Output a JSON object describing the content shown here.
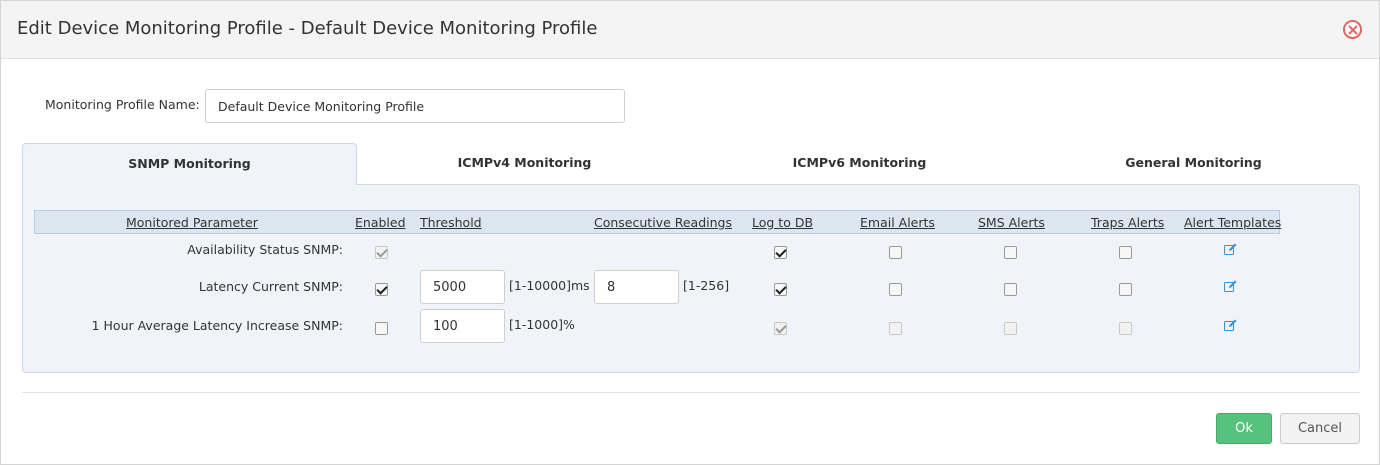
{
  "dialog": {
    "title": "Edit Device Monitoring Profile - Default Device Monitoring Profile",
    "close_icon": "close-circle-icon",
    "accent_close": "#e06666"
  },
  "profile": {
    "label": "Monitoring Profile Name:",
    "value": "Default Device Monitoring Profile"
  },
  "tabs": [
    {
      "label": "SNMP Monitoring",
      "active": true
    },
    {
      "label": "ICMPv4 Monitoring",
      "active": false
    },
    {
      "label": "ICMPv6 Monitoring",
      "active": false
    },
    {
      "label": "General Monitoring",
      "active": false
    }
  ],
  "grid": {
    "columns": {
      "parameter": "Monitored Parameter",
      "enabled": "Enabled",
      "threshold": "Threshold",
      "consecutive": "Consecutive Readings",
      "log": "Log to DB",
      "email": "Email Alerts",
      "sms": "SMS Alerts",
      "traps": "Traps Alerts",
      "templates": "Alert Templates"
    },
    "rows": [
      {
        "label": "Availability Status SNMP:",
        "enabled": {
          "checked": true,
          "disabled": true
        },
        "log": {
          "checked": true,
          "disabled": false
        },
        "email": {
          "checked": false,
          "disabled": false
        },
        "sms": {
          "checked": false,
          "disabled": false
        },
        "traps": {
          "checked": false,
          "disabled": false
        },
        "template_icon": "edit-icon"
      },
      {
        "label": "Latency Current SNMP:",
        "enabled": {
          "checked": true,
          "disabled": false
        },
        "threshold": "5000",
        "threshold_range": "[1-10000]ms",
        "consecutive": "8",
        "consecutive_range": "[1-256]",
        "log": {
          "checked": true,
          "disabled": false
        },
        "email": {
          "checked": false,
          "disabled": false
        },
        "sms": {
          "checked": false,
          "disabled": false
        },
        "traps": {
          "checked": false,
          "disabled": false
        },
        "template_icon": "edit-icon"
      },
      {
        "label": "1 Hour Average Latency Increase SNMP:",
        "enabled": {
          "checked": false,
          "disabled": false
        },
        "threshold": "100",
        "threshold_range": "[1-1000]%",
        "log": {
          "checked": true,
          "disabled": true
        },
        "email": {
          "checked": false,
          "disabled": true
        },
        "sms": {
          "checked": false,
          "disabled": true
        },
        "traps": {
          "checked": false,
          "disabled": true
        },
        "template_icon": "edit-icon"
      }
    ]
  },
  "footer": {
    "ok_label": "Ok",
    "cancel_label": "Cancel",
    "ok_color": "#56c27c"
  }
}
